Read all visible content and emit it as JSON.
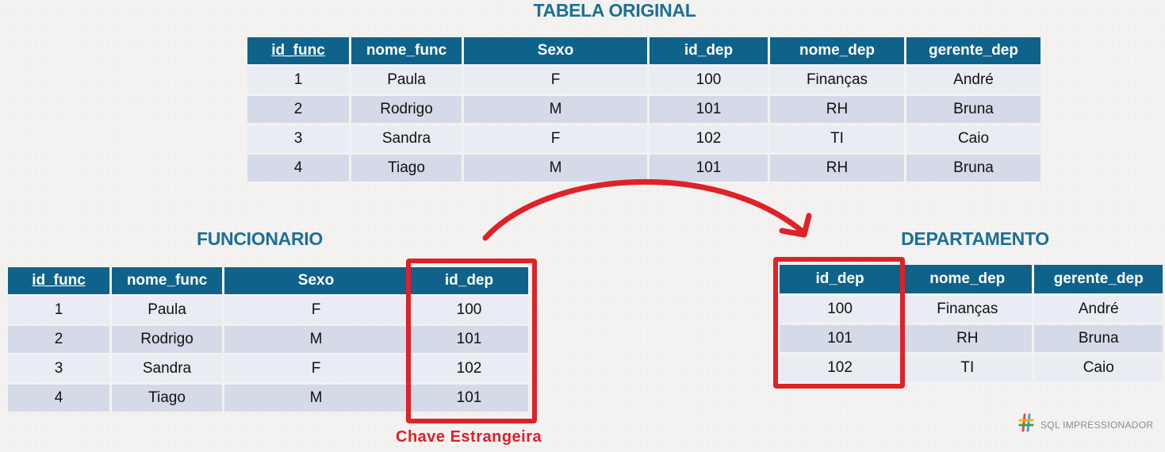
{
  "original": {
    "title": "TABELA ORIGINAL",
    "columns": [
      "id_func",
      "nome_func",
      "Sexo",
      "id_dep",
      "nome_dep",
      "gerente_dep"
    ],
    "rows": [
      [
        "1",
        "Paula",
        "F",
        "100",
        "Finanças",
        "André"
      ],
      [
        "2",
        "Rodrigo",
        "M",
        "101",
        "RH",
        "Bruna"
      ],
      [
        "3",
        "Sandra",
        "F",
        "102",
        "TI",
        "Caio"
      ],
      [
        "4",
        "Tiago",
        "M",
        "101",
        "RH",
        "Bruna"
      ]
    ]
  },
  "funcionario": {
    "title": "FUNCIONARIO",
    "columns": [
      "id_func",
      "nome_func",
      "Sexo",
      "id_dep"
    ],
    "rows": [
      [
        "1",
        "Paula",
        "F",
        "100"
      ],
      [
        "2",
        "Rodrigo",
        "M",
        "101"
      ],
      [
        "3",
        "Sandra",
        "F",
        "102"
      ],
      [
        "4",
        "Tiago",
        "M",
        "101"
      ]
    ]
  },
  "departamento": {
    "title": "DEPARTAMENTO",
    "columns": [
      "id_dep",
      "nome_dep",
      "gerente_dep"
    ],
    "rows": [
      [
        "100",
        "Finanças",
        "André"
      ],
      [
        "101",
        "RH",
        "Bruna"
      ],
      [
        "102",
        "TI",
        "Caio"
      ]
    ]
  },
  "foreign_key_caption": "Chave Estrangeira",
  "brand": {
    "name": "SQL IMPRESSIONADOR",
    "icon": "hash-logo-icon"
  },
  "colors": {
    "header": "#0f628a",
    "title": "#1c6f96",
    "highlight": "#df2128",
    "row_dark": "#d4dae7",
    "row_light": "#e9ecf3"
  }
}
